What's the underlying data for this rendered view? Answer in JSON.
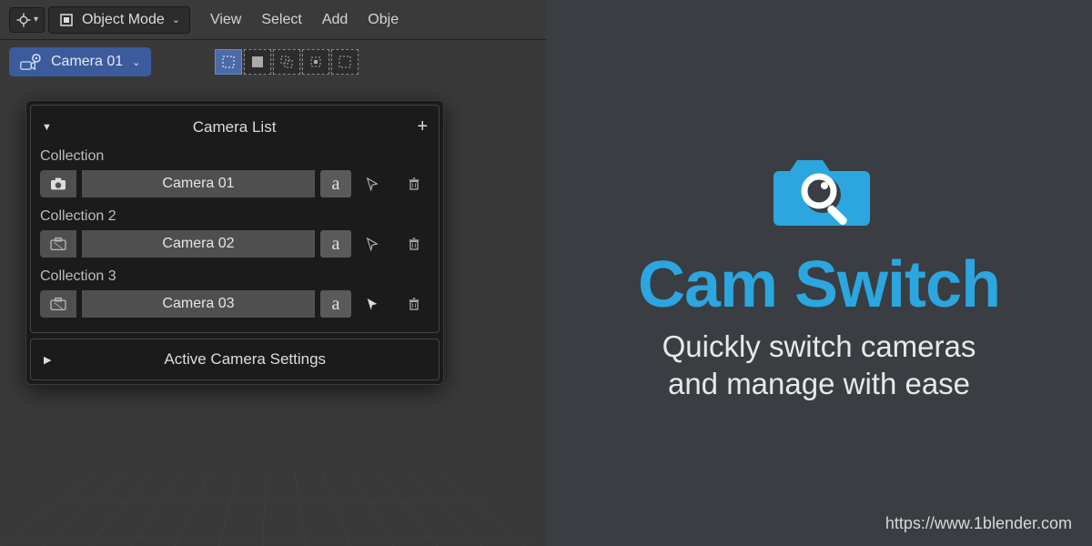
{
  "toolbar": {
    "mode_label": "Object Mode",
    "menu": [
      "View",
      "Select",
      "Add",
      "Obje"
    ]
  },
  "camera_switcher": {
    "active_label": "Camera 01"
  },
  "popup": {
    "title": "Camera List",
    "collections": [
      {
        "label": "Collection",
        "camera": "Camera 01",
        "active": true,
        "cursor_filled": false
      },
      {
        "label": "Collection 2",
        "camera": "Camera 02",
        "active": false,
        "cursor_filled": false
      },
      {
        "label": "Collection 3",
        "camera": "Camera 03",
        "active": false,
        "cursor_filled": true
      }
    ],
    "settings_label": "Active Camera Settings"
  },
  "marketing": {
    "title": "Cam Switch",
    "subtitle_line1": "Quickly switch cameras",
    "subtitle_line2": "and manage with ease",
    "url": "https://www.1blender.com",
    "accent": "#2ba6df"
  }
}
